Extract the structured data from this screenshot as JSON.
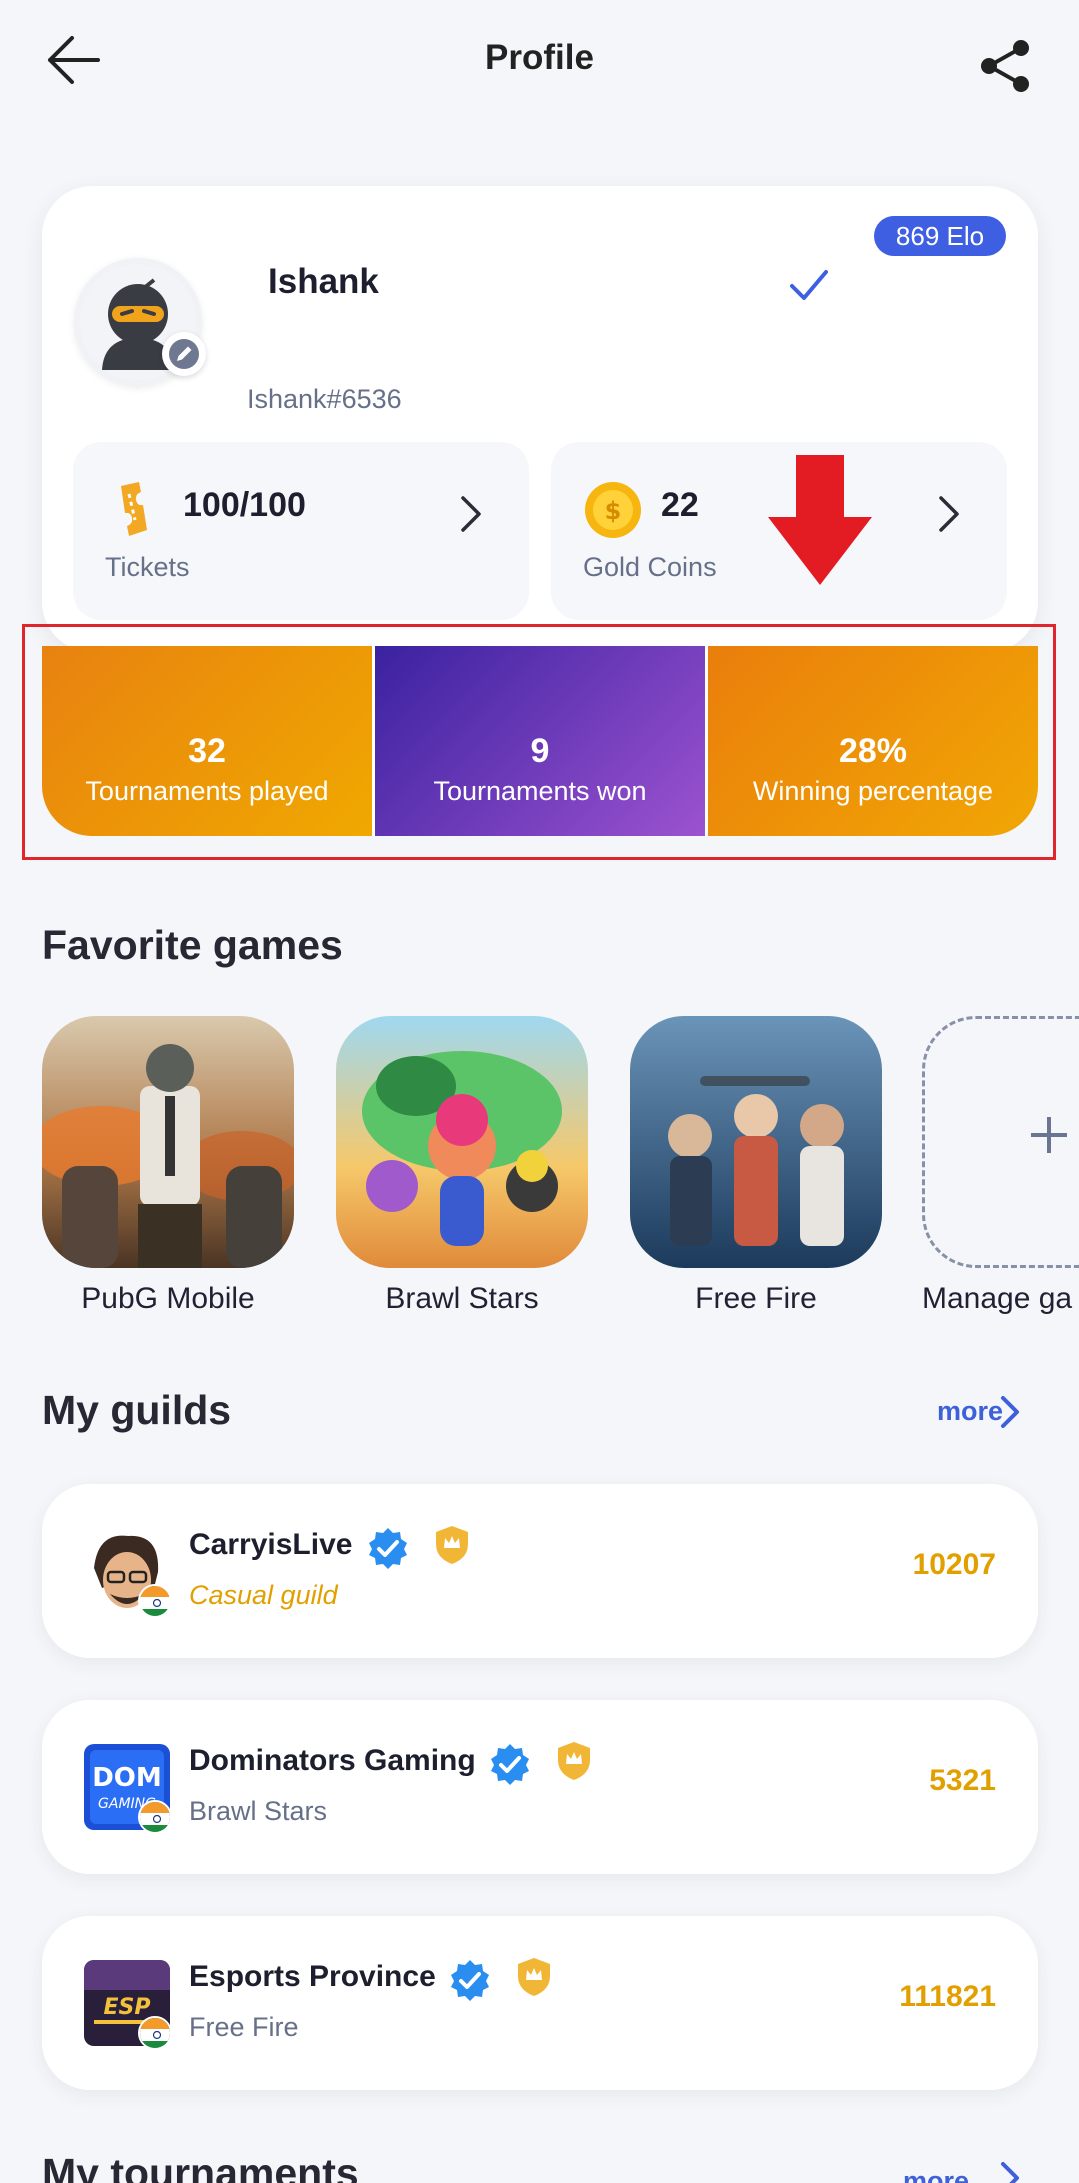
{
  "header": {
    "title": "Profile",
    "back_icon": "arrow-left-icon",
    "share_icon": "share-icon"
  },
  "profile": {
    "elo": "869 Elo",
    "username": "Ishank",
    "tag": "Ishank#6536",
    "tickets": {
      "value": "100/100",
      "label": "Tickets"
    },
    "coins": {
      "value": "22",
      "label": "Gold Coins"
    }
  },
  "summary": {
    "played": {
      "value": "32",
      "label": "Tournaments played"
    },
    "won": {
      "value": "9",
      "label": "Tournaments won"
    },
    "percentage": {
      "value": "28%",
      "label": "Winning percentage"
    }
  },
  "favorites": {
    "title": "Favorite games",
    "games": [
      {
        "name": "PubG Mobile"
      },
      {
        "name": "Brawl Stars"
      },
      {
        "name": "Free Fire"
      }
    ],
    "manage_label": "Manage ga"
  },
  "guilds": {
    "title": "My guilds",
    "more": "more",
    "items": [
      {
        "name": "CarryisLive",
        "sub": "Casual guild",
        "score": "10207"
      },
      {
        "name": "Dominators Gaming",
        "sub": "Brawl Stars",
        "score": "5321"
      },
      {
        "name": "Esports Province",
        "sub": "Free Fire",
        "score": "111821"
      }
    ]
  },
  "tournaments": {
    "title": "My tournaments",
    "more": "more"
  },
  "colors": {
    "accent": "#3f5fe3",
    "gold": "#e2a000",
    "highlight": "#e0252d",
    "orange": "#ee9a06",
    "purple": "#6a38b8"
  }
}
